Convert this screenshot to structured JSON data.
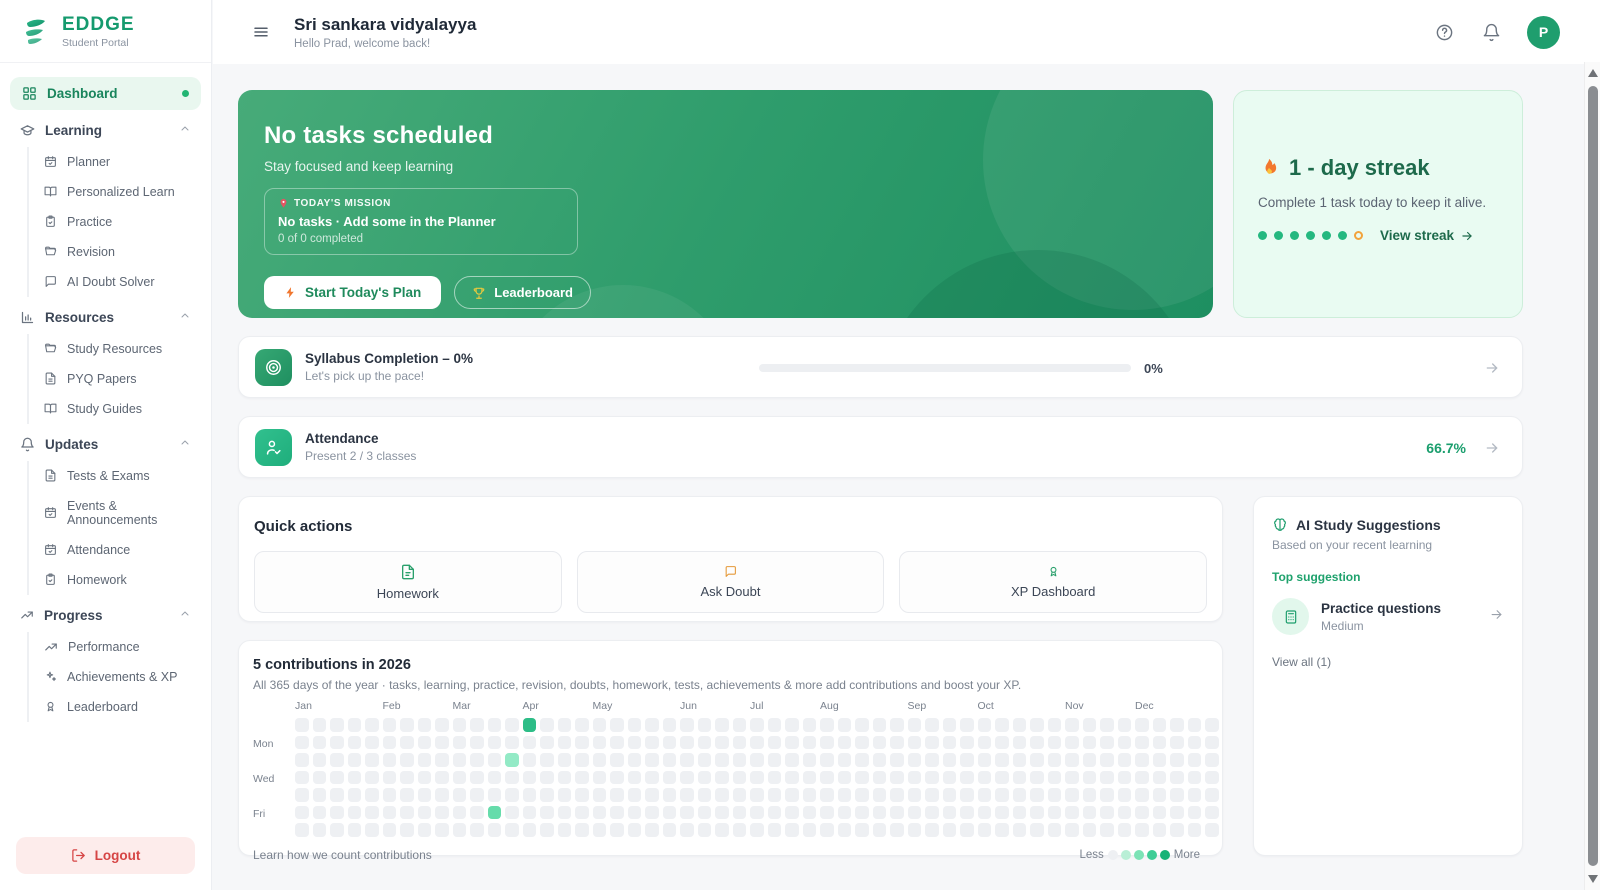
{
  "brand": {
    "name": "EDDGE",
    "tagline": "Student Portal"
  },
  "sidebar": {
    "dashboard_label": "Dashboard",
    "sections": [
      {
        "label": "Learning",
        "icon": "graduation-cap",
        "items": [
          {
            "label": "Planner",
            "icon": "calendar-check"
          },
          {
            "label": "Personalized Learn",
            "icon": "book-open"
          },
          {
            "label": "Practice",
            "icon": "clipboard-check"
          },
          {
            "label": "Revision",
            "icon": "folder"
          },
          {
            "label": "AI Doubt Solver",
            "icon": "chat"
          }
        ]
      },
      {
        "label": "Resources",
        "icon": "bar-chart",
        "items": [
          {
            "label": "Study Resources",
            "icon": "folder"
          },
          {
            "label": "PYQ Papers",
            "icon": "file-text"
          },
          {
            "label": "Study Guides",
            "icon": "book-open"
          }
        ]
      },
      {
        "label": "Updates",
        "icon": "bell",
        "items": [
          {
            "label": "Tests & Exams",
            "icon": "file-text"
          },
          {
            "label": "Events & Announcements",
            "icon": "calendar-check"
          },
          {
            "label": "Attendance",
            "icon": "calendar-check"
          },
          {
            "label": "Homework",
            "icon": "clipboard-check"
          }
        ]
      },
      {
        "label": "Progress",
        "icon": "trending-up",
        "items": [
          {
            "label": "Performance",
            "icon": "trending-up"
          },
          {
            "label": "Achievements & XP",
            "icon": "sparkles"
          },
          {
            "label": "Leaderboard",
            "icon": "medal"
          }
        ]
      }
    ],
    "logout_label": "Logout"
  },
  "header": {
    "title": "Sri sankara vidyalayya",
    "subtitle": "Hello Prad, welcome back!",
    "avatar_initial": "P"
  },
  "hero": {
    "title": "No tasks scheduled",
    "subtitle": "Stay focused and keep learning",
    "mission_label": "TODAY'S MISSION",
    "mission_text": "No tasks · Add some in the Planner",
    "mission_progress": "0 of 0 completed",
    "primary_button": "Start Today's Plan",
    "secondary_button": "Leaderboard"
  },
  "streak": {
    "title": "1 - day streak",
    "body": "Complete 1 task today to keep it alive.",
    "dots_filled": 6,
    "dots_ring": 1,
    "link_label": "View streak",
    "dot_color": "#25b880",
    "ring_color": "#f2a33c"
  },
  "syllabus": {
    "title": "Syllabus Completion – 0%",
    "subtitle": "Let's pick up the pace!",
    "percent_label": "0%",
    "progress_value": 0
  },
  "attendance": {
    "title": "Attendance",
    "subtitle": "Present 2 / 3 classes",
    "percent_label": "66.7%"
  },
  "quick_actions": {
    "title": "Quick actions",
    "items": [
      {
        "label": "Homework",
        "icon": "doc",
        "color": "#2aa06c"
      },
      {
        "label": "Ask Doubt",
        "icon": "chat",
        "color": "#e59a3a"
      },
      {
        "label": "XP Dashboard",
        "icon": "medal",
        "color": "#2aa06c"
      }
    ]
  },
  "ai_suggestions": {
    "title": "AI Study Suggestions",
    "subtitle": "Based on your recent learning",
    "top_label": "Top suggestion",
    "suggestion_title": "Practice questions",
    "suggestion_difficulty": "Medium",
    "view_all_label": "View all (1)"
  },
  "contributions": {
    "title": "5 contributions in 2026",
    "subtitle": "All 365 days of the year · tasks, learning, practice, revision, doubts, homework, tests, achievements & more add contributions and boost your XP.",
    "year": "2026",
    "total": 5,
    "months": [
      {
        "label": "Jan",
        "col": 0
      },
      {
        "label": "Feb",
        "col": 5
      },
      {
        "label": "Mar",
        "col": 9
      },
      {
        "label": "Apr",
        "col": 13
      },
      {
        "label": "May",
        "col": 17
      },
      {
        "label": "Jun",
        "col": 22
      },
      {
        "label": "Jul",
        "col": 26
      },
      {
        "label": "Aug",
        "col": 30
      },
      {
        "label": "Sep",
        "col": 35
      },
      {
        "label": "Oct",
        "col": 39
      },
      {
        "label": "Nov",
        "col": 44
      },
      {
        "label": "Dec",
        "col": 48
      }
    ],
    "day_labels": [
      {
        "label": "Mon",
        "row": 1
      },
      {
        "label": "Wed",
        "row": 3
      },
      {
        "label": "Fri",
        "row": 5
      }
    ],
    "weeks": 53,
    "rows": 7,
    "active_cells": [
      {
        "col": 13,
        "row": 0,
        "level": 3
      },
      {
        "col": 12,
        "row": 2,
        "level": 1
      },
      {
        "col": 11,
        "row": 5,
        "level": 2
      }
    ],
    "level_colors": [
      "#eef0f3",
      "#93eac6",
      "#66dcab",
      "#2dbd87",
      "#16a874"
    ],
    "legend_colors": [
      "#eef0f3",
      "#b9efd6",
      "#7ce3b6",
      "#3ecd96",
      "#16b277"
    ],
    "footer_link": "Learn how we count contributions",
    "less_label": "Less",
    "more_label": "More"
  }
}
